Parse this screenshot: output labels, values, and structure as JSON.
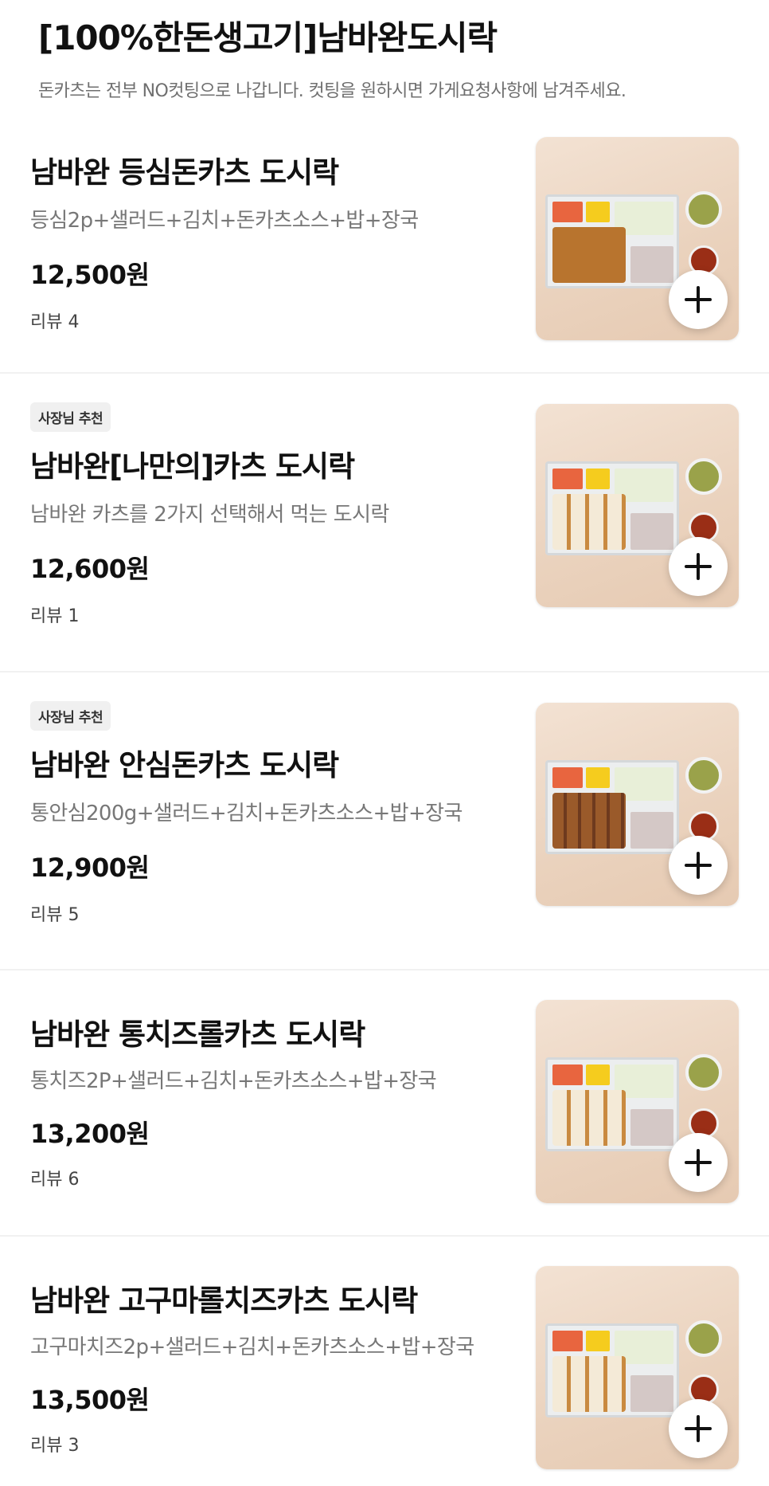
{
  "section": {
    "title": "[100%한돈생고기]남바완도시락",
    "notice": "돈카츠는 전부 NO컷팅으로 나갑니다. 컷팅을 원하시면 가게요청사항에 남겨주세요."
  },
  "items": [
    {
      "badge": "",
      "name": "남바완 등심돈카츠 도시락",
      "description": "등심2p+샐러드+김치+돈카츠소스+밥+장국",
      "price": "12,500원",
      "review": "리뷰 4",
      "image": "lunchbox-deungsim"
    },
    {
      "badge": "사장님 추천",
      "name": "남바완[나만의]카츠 도시락",
      "description": "남바완 카츠를 2가지 선택해서 먹는 도시락",
      "price": "12,600원",
      "review": "리뷰 1",
      "image": "lunchbox-custom"
    },
    {
      "badge": "사장님 추천",
      "name": "남바완 안심돈카츠 도시락",
      "description": "통안심200g+샐러드+김치+돈카츠소스+밥+장국",
      "price": "12,900원",
      "review": "리뷰 5",
      "image": "lunchbox-ansim"
    },
    {
      "badge": "",
      "name": "남바완 통치즈롤카츠 도시락",
      "description": "통치즈2P+샐러드+김치+돈카츠소스+밥+장국",
      "price": "13,200원",
      "review": "리뷰 6",
      "image": "lunchbox-cheese-roll"
    },
    {
      "badge": "",
      "name": "남바완 고구마롤치즈카츠 도시락",
      "description": "고구마치즈2p+샐러드+김치+돈카츠소스+밥+장국",
      "price": "13,500원",
      "review": "리뷰 3",
      "image": "lunchbox-sweetpotato-cheese"
    }
  ],
  "icons": {
    "add": "plus-icon"
  }
}
